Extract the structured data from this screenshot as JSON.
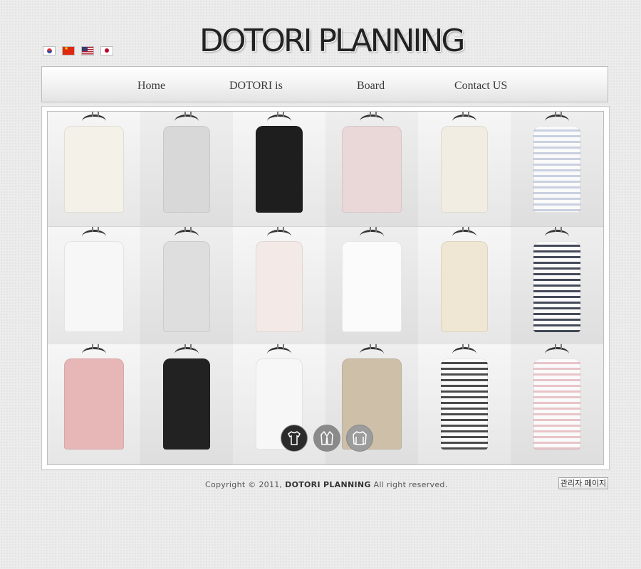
{
  "header": {
    "logo_text": "DOTORI PLANNING",
    "languages": [
      {
        "name": "korean-flag-icon"
      },
      {
        "name": "china-flag-icon"
      },
      {
        "name": "usa-flag-icon"
      },
      {
        "name": "japan-flag-icon"
      }
    ]
  },
  "nav": {
    "items": [
      {
        "label": "Home"
      },
      {
        "label": "DOTORI is"
      },
      {
        "label": "Board"
      },
      {
        "label": "Contact US"
      }
    ]
  },
  "gallery": {
    "items": [
      {
        "desc": "white lace blouse",
        "color": "#f4f1e8"
      },
      {
        "desc": "grey print tee",
        "color": "#d8d8d8"
      },
      {
        "desc": "black sleeveless top",
        "color": "#1e1e1e"
      },
      {
        "desc": "pink bow top",
        "color": "#ead7d7"
      },
      {
        "desc": "cream cardigan",
        "color": "#f1ede3"
      },
      {
        "desc": "blue stripe tee",
        "color": "#c9d0e0"
      },
      {
        "desc": "white print tee",
        "color": "#f7f7f7"
      },
      {
        "desc": "floral sleeveless top",
        "color": "#dedede"
      },
      {
        "desc": "pink ruffle cardigan",
        "color": "#f3e9e6"
      },
      {
        "desc": "white tee",
        "color": "#fbfbfb"
      },
      {
        "desc": "beige cardigan",
        "color": "#efe6d3"
      },
      {
        "desc": "navy stripe tee",
        "color": "#444a5a"
      },
      {
        "desc": "pink bolero",
        "color": "#e7b7b7"
      },
      {
        "desc": "black bolero",
        "color": "#222222"
      },
      {
        "desc": "white knit top",
        "color": "#f7f7f7"
      },
      {
        "desc": "beige knit top",
        "color": "#cdbfa8"
      },
      {
        "desc": "lace stripe tee",
        "color": "#4a4a4a"
      },
      {
        "desc": "pink stripe tee",
        "color": "#e8c4c8"
      }
    ]
  },
  "categories": [
    {
      "name": "tshirt-category-icon",
      "color": "#2b2b2b"
    },
    {
      "name": "jacket-category-icon",
      "color": "#8a8a8a"
    },
    {
      "name": "sweater-category-icon",
      "color": "#9c9c9c"
    }
  ],
  "footer": {
    "copyright_prefix": "Copyright © 2011,",
    "company": "DOTORI PLANNING",
    "copyright_suffix": "All right reserved."
  },
  "admin": {
    "label": "관리자 페이지"
  }
}
